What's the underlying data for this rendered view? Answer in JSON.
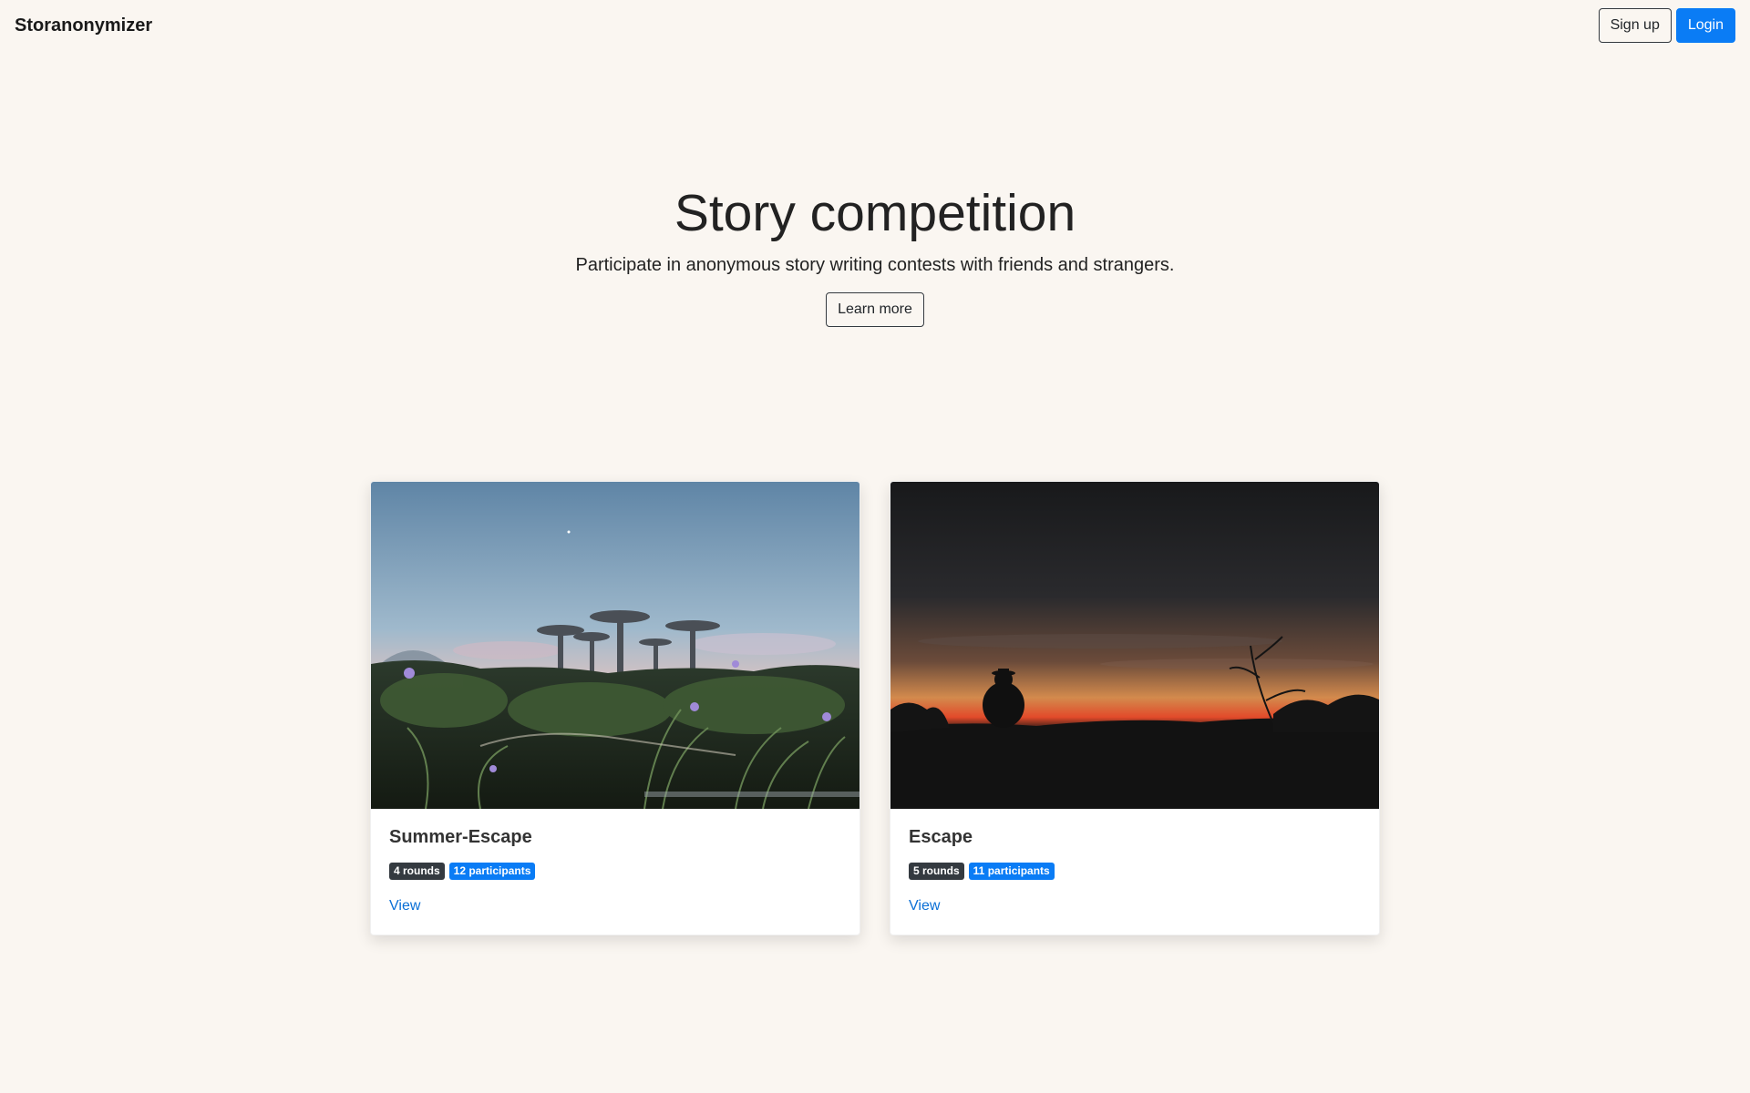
{
  "navbar": {
    "brand": "Storanonymizer",
    "signup_label": "Sign up",
    "login_label": "Login"
  },
  "hero": {
    "title": "Story competition",
    "lead": "Participate in anonymous story writing contests with friends and strangers.",
    "cta_label": "Learn more"
  },
  "competitions": [
    {
      "title": "Summer-Escape",
      "rounds": "4 rounds",
      "participants": "12 participants",
      "link_label": "View"
    },
    {
      "title": "Escape",
      "rounds": "5 rounds",
      "participants": "11 participants",
      "link_label": "View"
    }
  ],
  "colors": {
    "background": "#faf6f1",
    "primary": "#0a7cf5",
    "dark_badge": "#343a40"
  }
}
